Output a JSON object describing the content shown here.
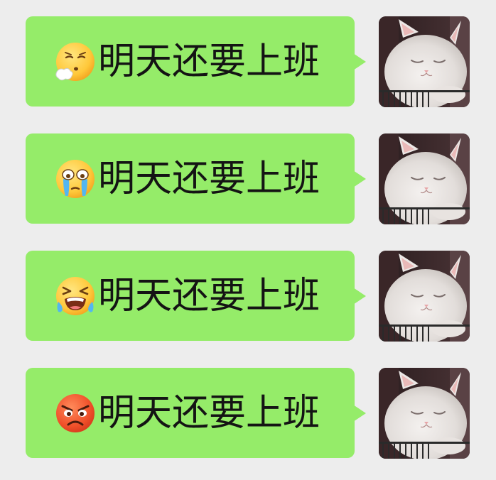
{
  "chat": {
    "messages": [
      {
        "emoji": "exhale-face-icon",
        "text": "明天还要上班"
      },
      {
        "emoji": "tearful-face-icon",
        "text": "明天还要上班"
      },
      {
        "emoji": "bawling-face-icon",
        "text": "明天还要上班"
      },
      {
        "emoji": "angry-face-icon",
        "text": "明天还要上班"
      }
    ],
    "avatar": "sleepy-white-cat-avatar"
  },
  "colors": {
    "background": "#ededed",
    "bubble": "#95ec69",
    "text": "#141414"
  }
}
